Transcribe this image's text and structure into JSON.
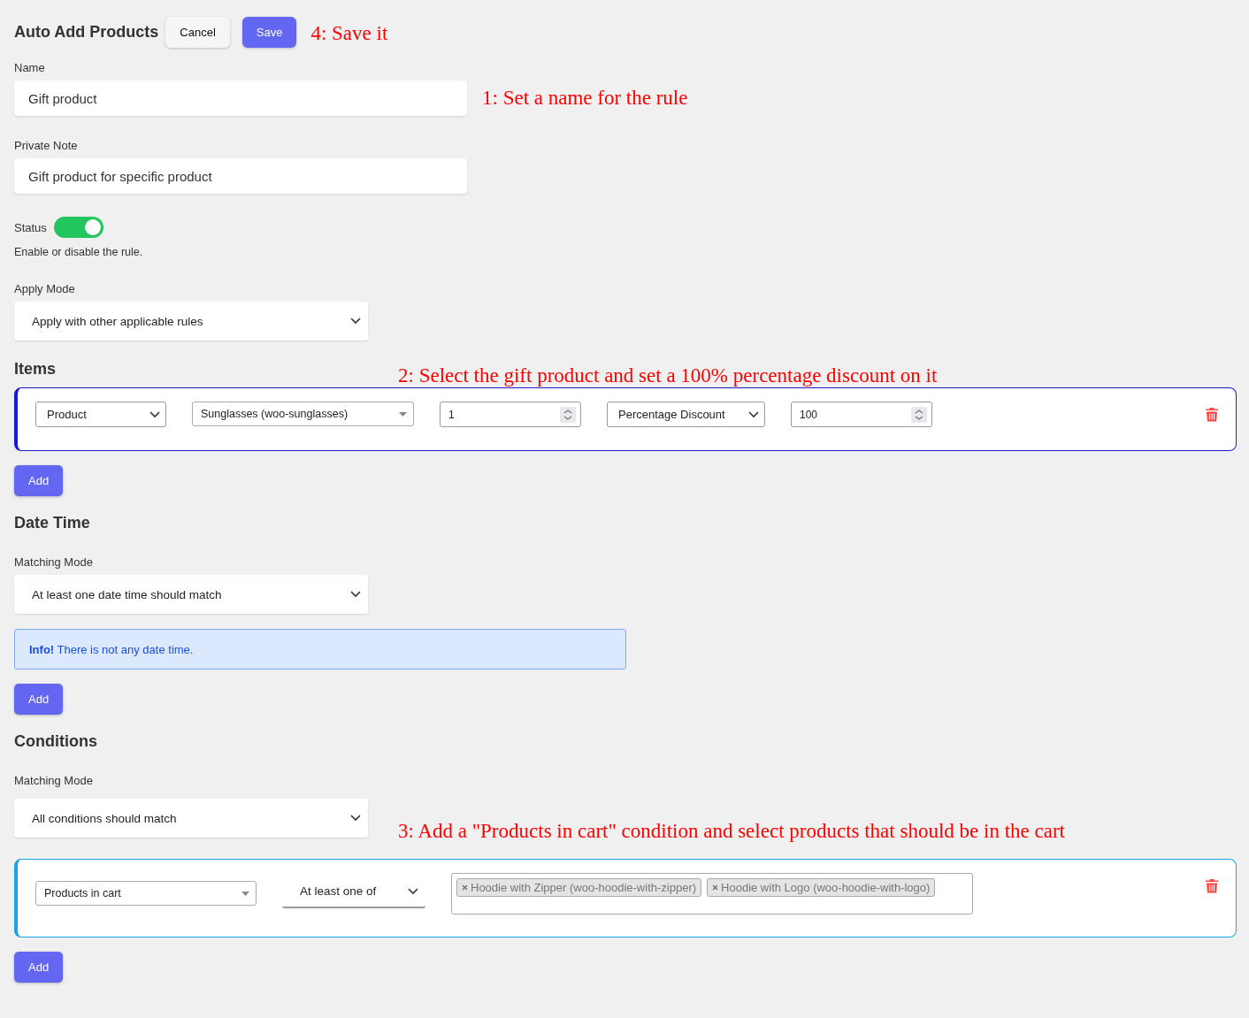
{
  "header": {
    "title": "Auto Add Products",
    "buttons": [
      {
        "label": "Cancel",
        "kind": "secondary"
      },
      {
        "label": "Save",
        "kind": "primary"
      }
    ],
    "note": "4: Save it"
  },
  "name": {
    "label": "Name",
    "value": "Gift product",
    "note": "1: Set a name for the rule"
  },
  "private_note": {
    "label": "Private Note",
    "value": "Gift product for specific product"
  },
  "status": {
    "label": "Status",
    "on": true,
    "help": "Enable or disable the rule."
  },
  "apply_mode": {
    "label": "Apply Mode",
    "value": "Apply with other applicable rules"
  },
  "items": {
    "title": "Items",
    "note": "2: Select the gift product and set a 100% percentage discount on it",
    "rows": [
      {
        "fields": [
          {
            "kind": "select",
            "value": "Product"
          },
          {
            "kind": "combo",
            "value": "Sunglasses (woo-sunglasses)"
          },
          {
            "kind": "number",
            "value": "1"
          },
          {
            "kind": "select",
            "value": "Percentage Discount"
          },
          {
            "kind": "number",
            "value": "100"
          }
        ]
      }
    ],
    "add_button": "Add"
  },
  "date_time": {
    "title": "Date Time",
    "matching_mode": {
      "label": "Matching Mode",
      "value": "At least one date time should match"
    },
    "info": "**Info!** There is not any date time.",
    "add_button": "Add"
  },
  "conditions": {
    "title": "Conditions",
    "matching_mode": {
      "label": "Matching Mode",
      "value": "All conditions should match"
    },
    "note": "3: Add a \"Products in cart\" condition and select products that should be in the cart",
    "rows": [
      {
        "fields": [
          {
            "kind": "combo",
            "value": "Products in cart"
          },
          {
            "kind": "underline",
            "value": "At least one of"
          },
          {
            "kind": "tags",
            "tags": [
              "Hoodie with Zipper (woo-hoodie-with-zipper)",
              "Hoodie with Logo (woo-hoodie-with-logo)"
            ]
          }
        ]
      }
    ],
    "add_button": "Add"
  }
}
